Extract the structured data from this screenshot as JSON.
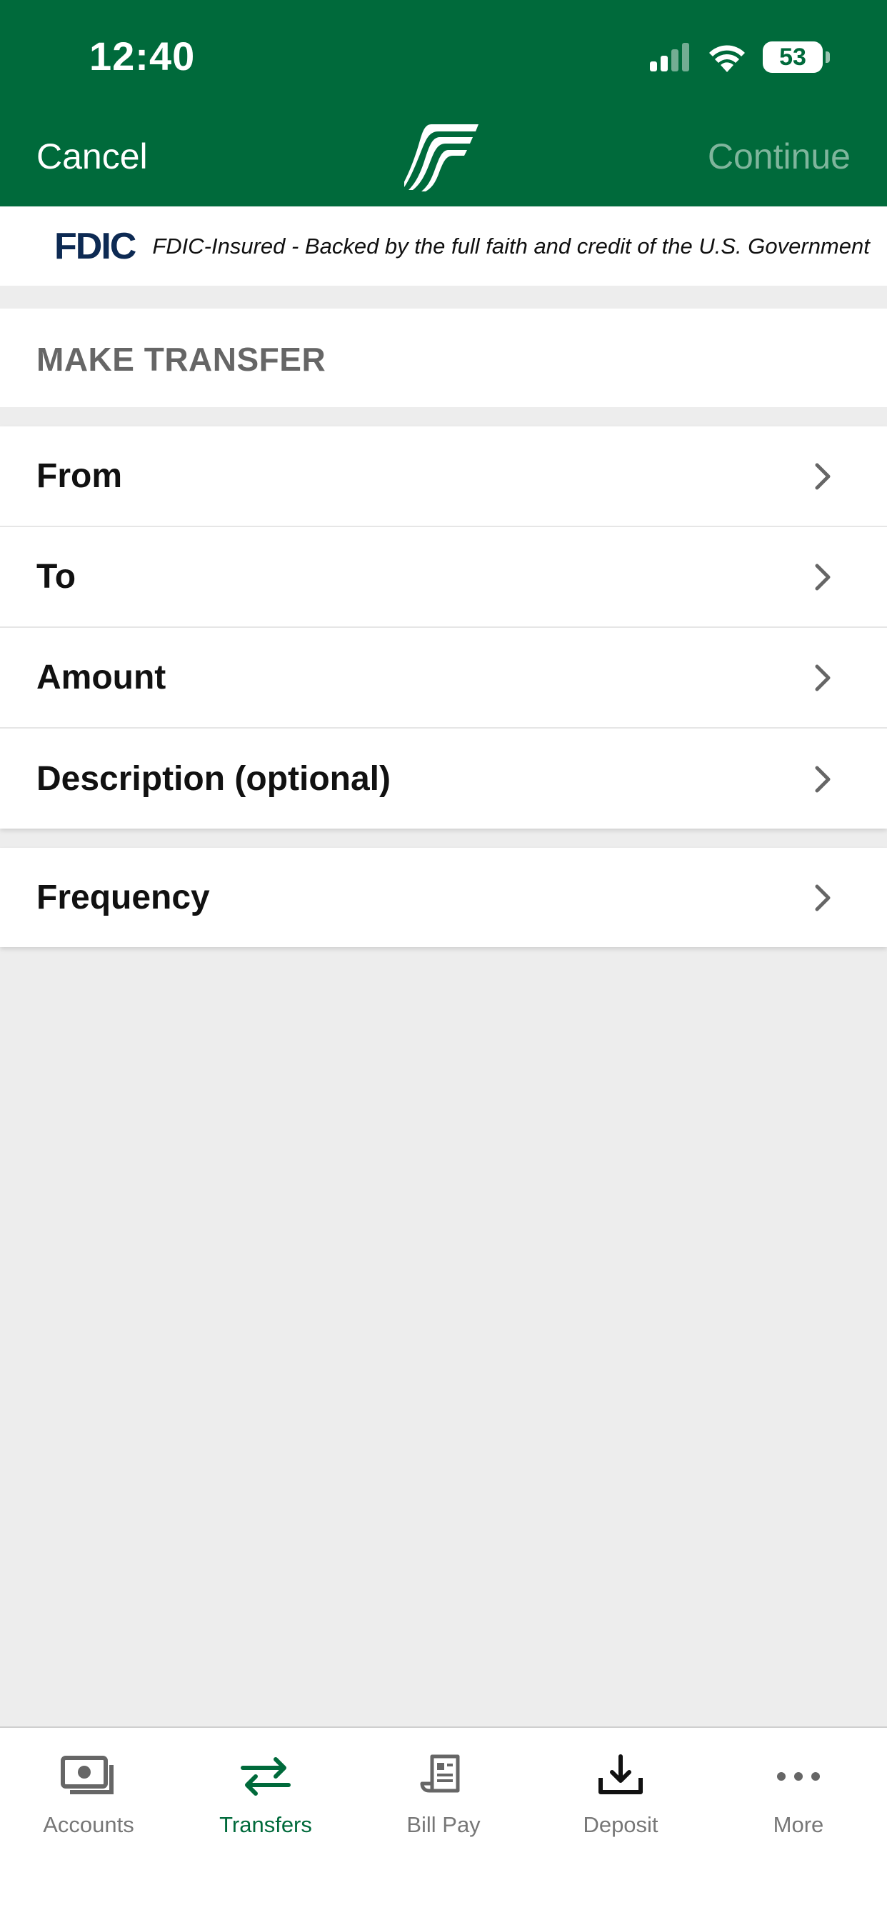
{
  "status_bar": {
    "time": "12:40",
    "battery": "53"
  },
  "nav": {
    "cancel_label": "Cancel",
    "continue_label": "Continue"
  },
  "fdic": {
    "logo_text": "FDIC",
    "notice": "FDIC-Insured - Backed by the full faith and credit of the U.S. Government"
  },
  "section": {
    "title": "MAKE TRANSFER"
  },
  "form_rows": [
    {
      "label": "From"
    },
    {
      "label": "To"
    },
    {
      "label": "Amount"
    },
    {
      "label": "Description (optional)"
    }
  ],
  "frequency_row": {
    "label": "Frequency"
  },
  "tabbar": {
    "items": [
      {
        "label": "Accounts",
        "icon": "accounts-icon"
      },
      {
        "label": "Transfers",
        "icon": "transfers-icon",
        "active": true
      },
      {
        "label": "Bill Pay",
        "icon": "bill-pay-icon"
      },
      {
        "label": "Deposit",
        "icon": "deposit-icon"
      },
      {
        "label": "More",
        "icon": "more-icon"
      }
    ]
  },
  "colors": {
    "brand_green": "#006a3b",
    "continue_disabled": "#7fb59c",
    "fdic_navy": "#0d2a53"
  }
}
